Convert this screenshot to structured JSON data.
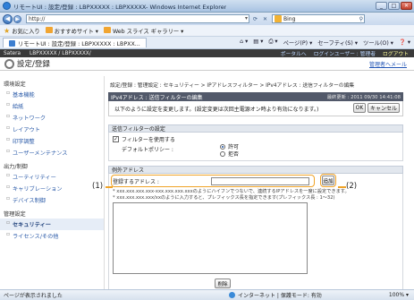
{
  "window": {
    "title": "リモートUI : 設定/登録 : LBPXXXXX : LBPXXXXX- Windows Internet Explorer",
    "minimize": "_",
    "maximize": "□",
    "close": "✕"
  },
  "address": {
    "url": "http://",
    "search_text": "Bing"
  },
  "favorites": {
    "favorites_label": "お気に入り",
    "suggested_label": "おすすめサイト ▾",
    "webslice_label": "Web スライス ギャラリー ▾"
  },
  "tab": {
    "label": "リモートUI : 設定/登録 : LBPXXXXX : LBPXX...",
    "page_menu": "ページ(P) ▾",
    "safety_menu": "セーフティ(S) ▾",
    "tools_menu": "ツール(O) ▾",
    "help_menu": "❓ ▾"
  },
  "brandbar": {
    "brand": "Satera",
    "device": "LBPXXXXX / LBPXXXXX/",
    "portal": "ポータルへ",
    "login_user": "ログインユーザー : 管理者",
    "logout": "ログアウト"
  },
  "header": {
    "title": "設定/登録",
    "mgmt_mail": "管理者へメール"
  },
  "sidebar": {
    "group1": "環境設定",
    "items1": [
      "基本機能",
      "給紙",
      "ネットワーク",
      "レイアウト",
      "印字調整",
      "ユーザーメンテナンス"
    ],
    "group2": "出力/制御",
    "items2": [
      "ユーティリティー",
      "キャリブレーション",
      "デバイス制御"
    ],
    "group3": "管理設定",
    "items3": [
      "セキュリティー",
      "ライセンス/その他"
    ]
  },
  "content": {
    "breadcrumb": "設定/登録 : 管理設定 : セキュリティー > IPアドレスフィルター > IPv4アドレス : 送信フィルターの編集",
    "panel_title": "IPv4アドレス : 送信フィルターの編集",
    "updated": "最終更新 : 2011 09/30 14:41:08",
    "notice": "以下のように設定を変更します。(設定変更は次回主電源オン時より有効になります。)",
    "ok_label": "OK",
    "cancel_label": "キャンセル",
    "filter_section": "送信フィルターの設定",
    "use_filter_label": "フィルターを使用する",
    "use_filter_checked": true,
    "default_policy_label": "デフォルトポリシー :",
    "policy_allow": "許可",
    "policy_deny": "拒否",
    "policy_selected": "許可",
    "except_section": "例外アドレス",
    "register_label": "登録するアドレス :",
    "register_value": "",
    "add_label": "追加",
    "note_line1": "* xxx.xxx.xxx.xxx-xxx.xxx.xxx.xxxのようにハイフンでつないで、連続するIPアドレスを一度に設定できます。",
    "note_line2": "* xxx.xxx.xxx.xxx/xxのように入力すると、プレフィックス長を指定できます(プレフィックス長 : 1〜32)",
    "delete_label": "削除"
  },
  "callouts": {
    "c1": "(1)",
    "c2": "(2)"
  },
  "status": {
    "left": "ページが表示されました",
    "zone": "インターネット | 保護モード: 有効",
    "zoom": "100% ▾"
  },
  "colors": {
    "highlight": "#f0a327",
    "panel_header": "#52596a",
    "link": "#2a5aa8"
  }
}
